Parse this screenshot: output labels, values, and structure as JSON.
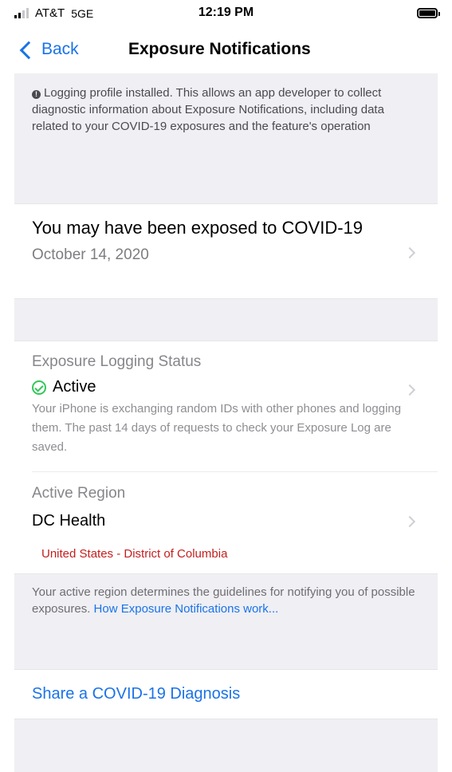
{
  "status_bar": {
    "carrier": "AT&T",
    "network": "5GE",
    "time": "12:19 PM"
  },
  "nav": {
    "back_label": "Back",
    "title": "Exposure Notifications"
  },
  "banner": {
    "text": "Logging profile installed. This allows an app developer to collect diagnostic information about Exposure Notifications, including data related to your COVID-19 exposures and the feature's operation"
  },
  "exposure": {
    "title": "You may have been exposed to COVID-19",
    "date": "October 14, 2020"
  },
  "logging_status": {
    "label": "Exposure Logging Status",
    "status": "Active",
    "description": "Your iPhone is exchanging random IDs with other phones and logging them. The past 14 days of requests to check your Exposure Log are saved."
  },
  "region": {
    "label": "Active Region",
    "name": "DC Health",
    "location": "United States - District of Columbia"
  },
  "footer": {
    "text": "Your active region determines the guidelines for notifying you of possible exposures.",
    "link": "How Exposure Notifications work..."
  },
  "share": {
    "label": "Share a COVID-19 Diagnosis"
  },
  "colors": {
    "accent": "#1a73e8",
    "active_green": "#34c759",
    "region_red": "#c41e1e",
    "group_background": "#efeff4"
  }
}
